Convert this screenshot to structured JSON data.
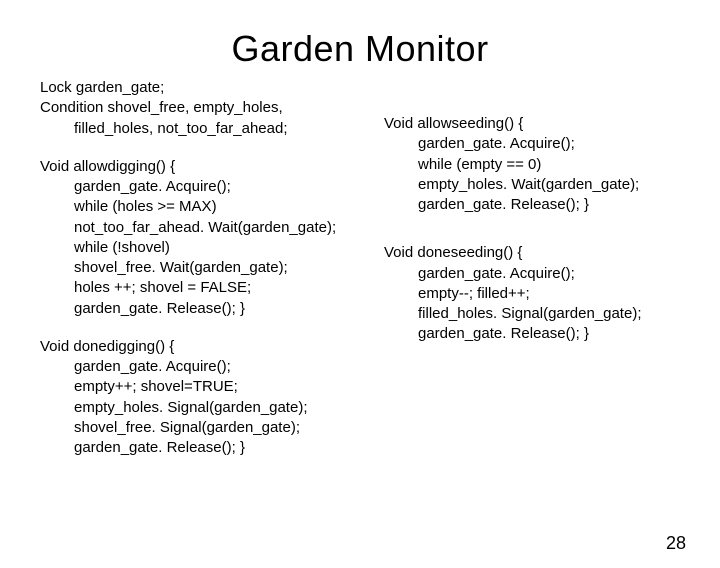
{
  "title": "Garden Monitor",
  "left": {
    "decl1": "Lock garden_gate;",
    "decl2": "Condition shovel_free, empty_holes,",
    "decl3": "filled_holes, not_too_far_ahead;",
    "fn1_sig": "Void allowdigging() {",
    "fn1_l1": "garden_gate. Acquire();",
    "fn1_l2": "while (holes >= MAX)",
    "fn1_l3": "not_too_far_ahead. Wait(garden_gate);",
    "fn1_l4": "while (!shovel)",
    "fn1_l5": "shovel_free. Wait(garden_gate);",
    "fn1_l6": "holes ++; shovel = FALSE;",
    "fn1_l7": "garden_gate. Release(); }",
    "fn2_sig": "Void donedigging() {",
    "fn2_l1": "garden_gate. Acquire();",
    "fn2_l2": "empty++; shovel=TRUE;",
    "fn2_l3": "empty_holes. Signal(garden_gate);",
    "fn2_l4": "shovel_free. Signal(garden_gate);",
    "fn2_l5": "garden_gate. Release(); }"
  },
  "right": {
    "fn3_sig": "Void allowseeding() {",
    "fn3_l1": "garden_gate. Acquire();",
    "fn3_l2": "while (empty == 0)",
    "fn3_l3": "empty_holes. Wait(garden_gate);",
    "fn3_l4": "garden_gate. Release(); }",
    "fn4_sig": "Void doneseeding() {",
    "fn4_l1": "garden_gate. Acquire();",
    "fn4_l2": "empty--; filled++;",
    "fn4_l3": "filled_holes. Signal(garden_gate);",
    "fn4_l4": "garden_gate. Release(); }"
  },
  "page_number": "28"
}
